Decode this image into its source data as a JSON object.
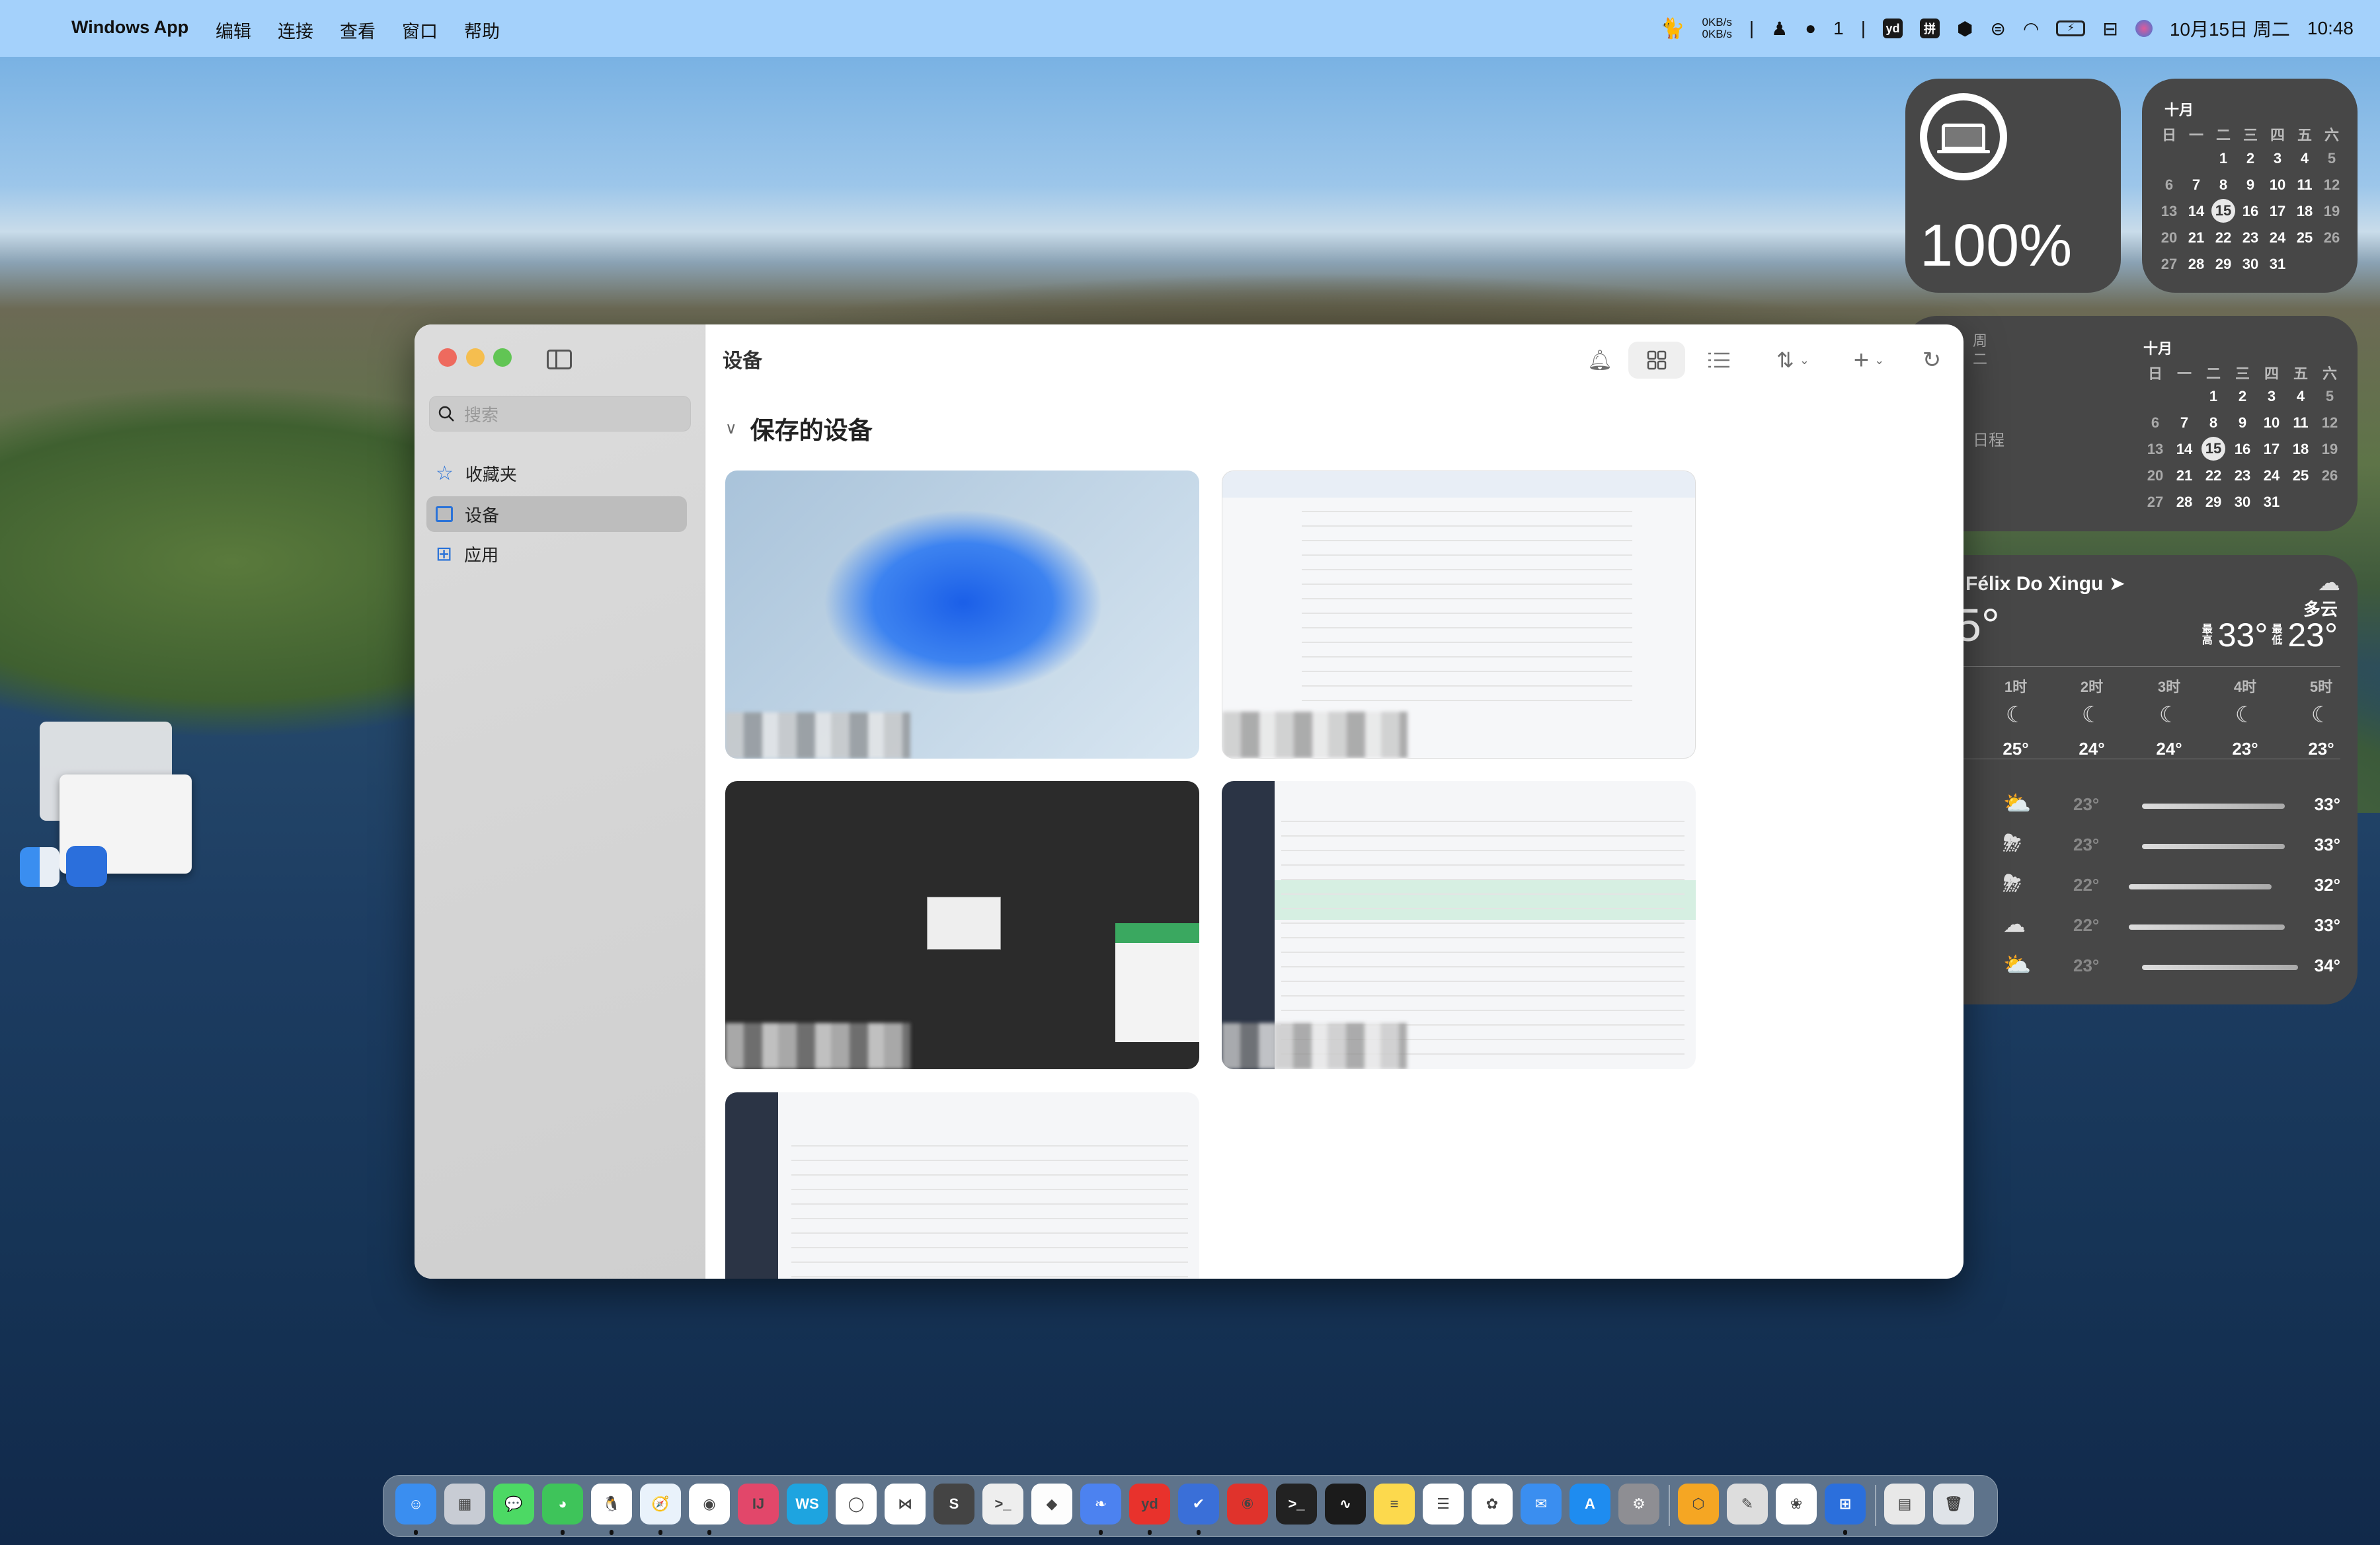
{
  "menubar": {
    "app_name": "Windows App",
    "items": [
      "编辑",
      "连接",
      "查看",
      "窗口",
      "帮助"
    ],
    "net_up": "0KB/s",
    "net_down": "0KB/s",
    "wechat_count": "1",
    "yd": "yd",
    "ime": "拼",
    "date": "10月15日 周二",
    "time": "10:48"
  },
  "battery_widget": {
    "percent": "100%",
    "level": 100
  },
  "calendar_small": {
    "month": "十月",
    "weekdays": [
      "日",
      "一",
      "二",
      "三",
      "四",
      "五",
      "六"
    ],
    "first_weekday": 2,
    "days": 31,
    "today": 15
  },
  "calendar_large": {
    "month": "十月",
    "day_label": "周二",
    "events_text": "日程",
    "weekdays": [
      "日",
      "一",
      "二",
      "三",
      "四",
      "五",
      "六"
    ],
    "first_weekday": 2,
    "days": 31,
    "today": 15
  },
  "weather": {
    "location": "Félix Do Xingu",
    "current_temp": "5°",
    "condition": "多云",
    "high_label": "最高",
    "high": "33°",
    "low_label": "最低",
    "low": "23°",
    "hourly": [
      {
        "time": "1时",
        "icon": "moon-stars",
        "temp": "25°"
      },
      {
        "time": "2时",
        "icon": "moon-stars",
        "temp": "24°"
      },
      {
        "time": "3时",
        "icon": "moon-stars",
        "temp": "24°"
      },
      {
        "time": "4时",
        "icon": "moon-stars",
        "temp": "23°"
      },
      {
        "time": "5时",
        "icon": "moon-stars",
        "temp": "23°"
      }
    ],
    "daily": [
      {
        "icon": "cloud-sun",
        "low": "23°",
        "high": "33°"
      },
      {
        "icon": "cloud-bolt-rain",
        "low": "23°",
        "high": "33°"
      },
      {
        "icon": "cloud-bolt-rain",
        "low": "22°",
        "high": "32°"
      },
      {
        "icon": "cloud",
        "low": "22°",
        "high": "33°"
      },
      {
        "icon": "cloud-sun",
        "low": "23°",
        "high": "34°"
      }
    ]
  },
  "window": {
    "title": "设备",
    "search_placeholder": "搜索",
    "sidebar": [
      {
        "label": "收藏夹",
        "icon": "star-icon"
      },
      {
        "label": "设备",
        "icon": "monitor-icon",
        "selected": true
      },
      {
        "label": "应用",
        "icon": "apps-icon"
      }
    ],
    "section_title": "保存的设备",
    "view_mode": "grid",
    "devices": [
      {
        "type": "windows-11-desktop"
      },
      {
        "type": "file-explorer"
      },
      {
        "type": "windows-server-dialog"
      },
      {
        "type": "web-admin"
      },
      {
        "type": "web-admin-table"
      }
    ]
  },
  "dock": {
    "apps": [
      {
        "name": "finder",
        "color": "#3a8ef0",
        "glyph": "☺",
        "running": true
      },
      {
        "name": "launchpad",
        "color": "#c8ccd4",
        "glyph": "▦"
      },
      {
        "name": "messages",
        "color": "#4cd964",
        "glyph": "💬"
      },
      {
        "name": "wechat",
        "color": "#3ec45a",
        "glyph": "◕",
        "running": true
      },
      {
        "name": "qq",
        "color": "#ffffff",
        "glyph": "🐧",
        "running": true
      },
      {
        "name": "safari",
        "color": "#e9f2fb",
        "glyph": "🧭",
        "running": true
      },
      {
        "name": "chrome",
        "color": "#ffffff",
        "glyph": "◉",
        "running": true
      },
      {
        "name": "intellij",
        "color": "#e2476a",
        "glyph": "IJ"
      },
      {
        "name": "webstorm",
        "color": "#1ea4e0",
        "glyph": "WS"
      },
      {
        "name": "some-app",
        "color": "#ffffff",
        "glyph": "◯"
      },
      {
        "name": "vscode",
        "color": "#ffffff",
        "glyph": "⋈"
      },
      {
        "name": "sublime",
        "color": "#444444",
        "glyph": "S"
      },
      {
        "name": "chat",
        "color": "#eeeeee",
        "glyph": ">_"
      },
      {
        "name": "sketch",
        "color": "#fdfdfd",
        "glyph": "◆"
      },
      {
        "name": "bird-app",
        "color": "#4c82f0",
        "glyph": "❧",
        "running": true
      },
      {
        "name": "youdao",
        "color": "#e8322c",
        "glyph": "yd",
        "running": true
      },
      {
        "name": "todo",
        "color": "#3a6fd8",
        "glyph": "✔",
        "running": true
      },
      {
        "name": "netease-music",
        "color": "#e0332c",
        "glyph": "⑥"
      },
      {
        "name": "terminal",
        "color": "#222222",
        "glyph": ">_"
      },
      {
        "name": "activity-monitor",
        "color": "#1b1b1b",
        "glyph": "∿"
      },
      {
        "name": "notes",
        "color": "#fcd94d",
        "glyph": "≡"
      },
      {
        "name": "reminders",
        "color": "#ffffff",
        "glyph": "☰"
      },
      {
        "name": "photos",
        "color": "#ffffff",
        "glyph": "✿"
      },
      {
        "name": "mail",
        "color": "#3a8ef0",
        "glyph": "✉"
      },
      {
        "name": "app-store",
        "color": "#1e8cf0",
        "glyph": "A"
      },
      {
        "name": "system-settings",
        "color": "#8e8e93",
        "glyph": "⚙"
      },
      {
        "name": "hex-app",
        "color": "#f5a623",
        "glyph": "⬡"
      },
      {
        "name": "pen-app",
        "color": "#dddddd",
        "glyph": "✎"
      },
      {
        "name": "flower-app",
        "color": "#ffffff",
        "glyph": "❀"
      },
      {
        "name": "windows-app",
        "color": "#2b6fdc",
        "glyph": "⊞",
        "running": true
      },
      {
        "name": "files",
        "color": "#e8e8e8",
        "glyph": "▤"
      },
      {
        "name": "trash",
        "color": "#dfe3e8",
        "glyph": "🗑"
      }
    ]
  }
}
